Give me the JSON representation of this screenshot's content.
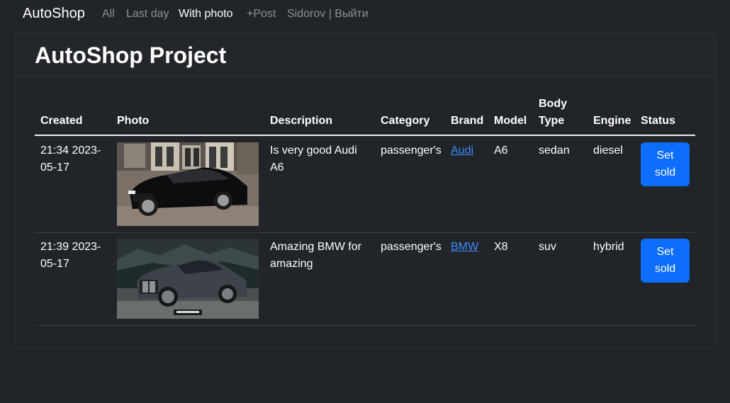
{
  "navbar": {
    "brand": "AutoShop",
    "links": [
      {
        "label": "All"
      },
      {
        "label": "Last day"
      },
      {
        "label": "With photo"
      },
      {
        "label": "+Post"
      },
      {
        "label": "Sidorov | Выйти"
      }
    ],
    "active": "With photo"
  },
  "page": {
    "title": "AutoShop Project"
  },
  "table": {
    "headers": {
      "created": "Created",
      "photo": "Photo",
      "description": "Description",
      "category": "Category",
      "brand": "Brand",
      "model": "Model",
      "body_type_1": "Body",
      "body_type_2": "Type",
      "engine": "Engine",
      "status": "Status"
    },
    "rows": [
      {
        "created_1": "21:34 2023-",
        "created_2": "05-17",
        "photo": "black-audi-a6-photo",
        "description_1": "Is very good Audi",
        "description_2": "A6",
        "category": "passenger's",
        "brand": "Audi",
        "model": "A6",
        "body_type": "sedan",
        "engine": "diesel",
        "button_1": "Set",
        "button_2": "sold"
      },
      {
        "created_1": "21:39 2023-",
        "created_2": "05-17",
        "photo": "grey-bmw-x8-photo",
        "description_1": "Amazing BMW for",
        "description_2": "amazing",
        "category": "passenger's",
        "brand": "BMW",
        "model": "X8",
        "body_type": "suv",
        "engine": "hybrid",
        "button_1": "Set",
        "button_2": "sold"
      }
    ]
  },
  "colors": {
    "background": "#212529",
    "primary_button": "#0d6efd",
    "link": "#3d8bfd"
  }
}
